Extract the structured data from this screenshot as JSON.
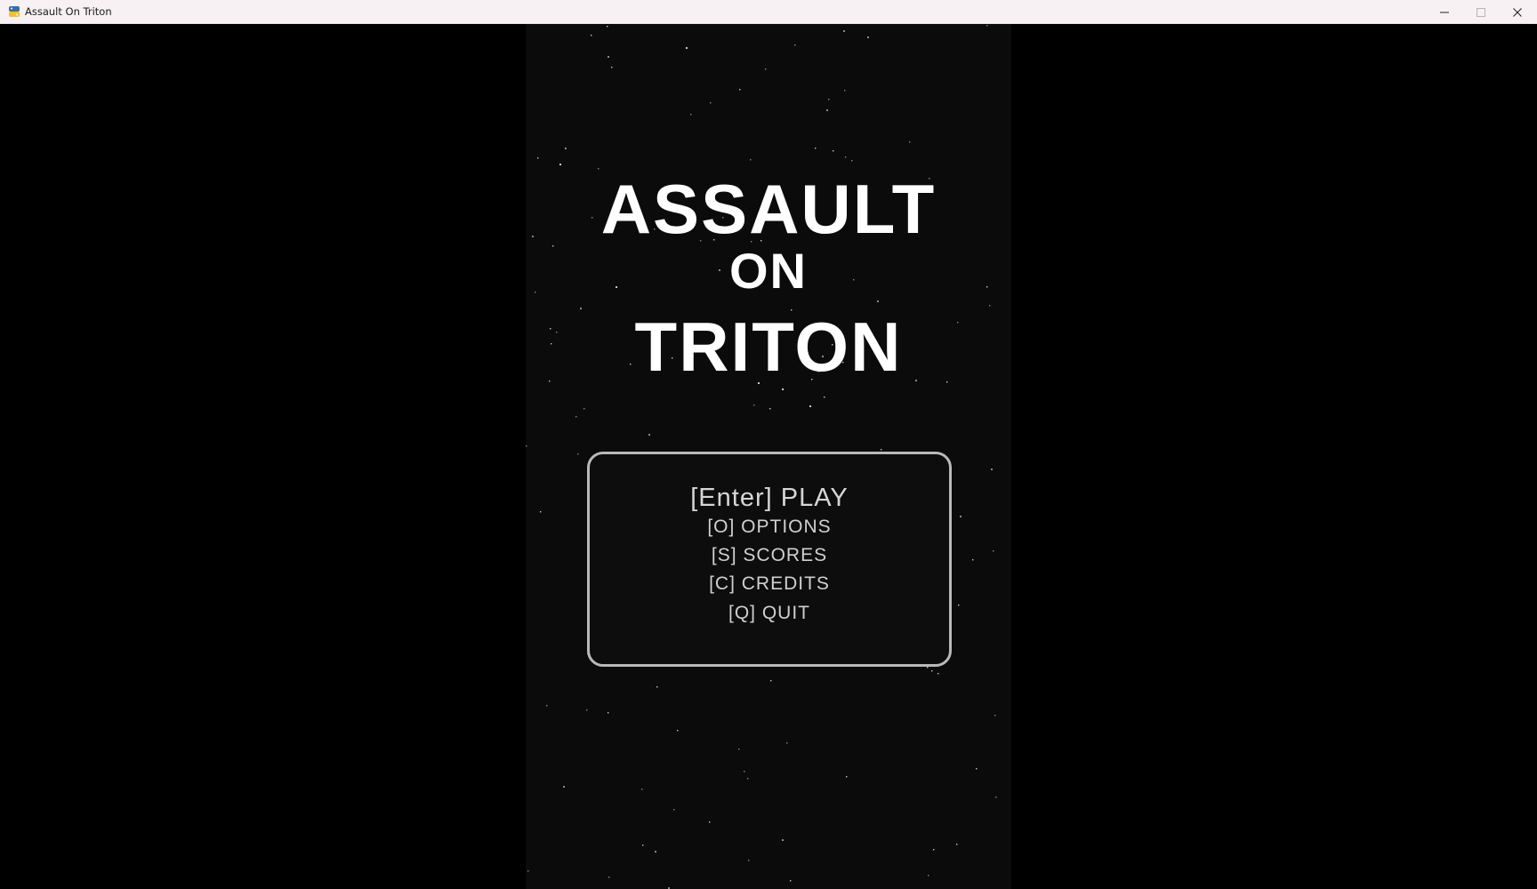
{
  "window": {
    "title": "Assault On Triton",
    "icon": "python-icon",
    "controls": [
      "minimize-icon",
      "maximize-icon",
      "close-icon"
    ]
  },
  "game": {
    "title_line1": "ASSAULT",
    "title_line2": "ON",
    "title_line3": "TRITON",
    "menu": [
      {
        "label": "[Enter] PLAY"
      },
      {
        "label": "[O] OPTIONS"
      },
      {
        "label": "[S] SCORES"
      },
      {
        "label": "[C] CREDITS"
      },
      {
        "label": "[Q] QUIT"
      }
    ]
  },
  "colors": {
    "background": "#000000",
    "play_field": "#0b0b0c",
    "title_text": "#ffffff",
    "menu_text": "#d0d0d0",
    "menu_border": "#b9b9b9",
    "titlebar": "#f8f1f3"
  }
}
